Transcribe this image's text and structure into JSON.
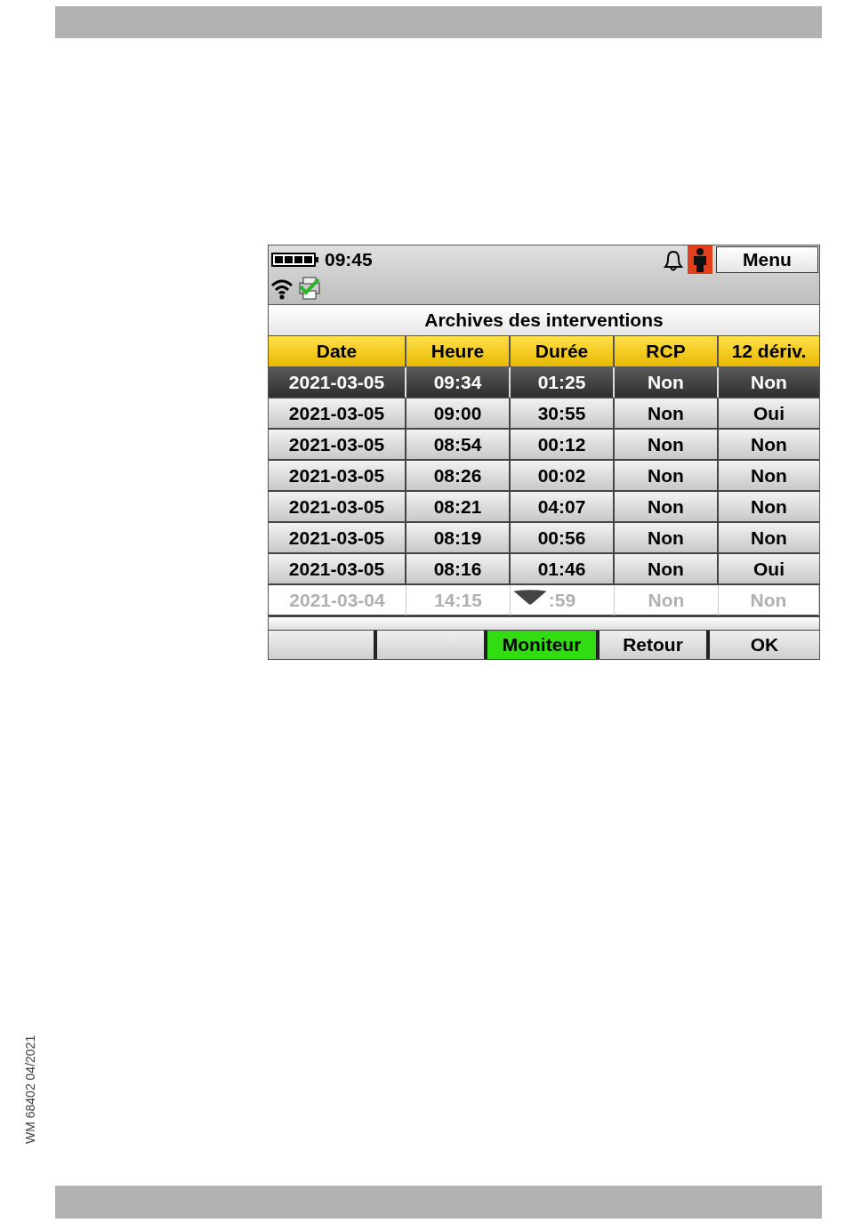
{
  "document_code": "WM 68402 04/2021",
  "device_screen": {
    "status_bar": {
      "time": "09:45",
      "menu_button": "Menu"
    },
    "title": "Archives des interventions",
    "table": {
      "columns": [
        "Date",
        "Heure",
        "Durée",
        "RCP",
        "12 dériv."
      ],
      "rows": [
        {
          "cells": [
            "2021-03-05",
            "09:34",
            "01:25",
            "Non",
            "Non"
          ],
          "selected": true,
          "faded": false
        },
        {
          "cells": [
            "2021-03-05",
            "09:00",
            "30:55",
            "Non",
            "Oui"
          ],
          "selected": false,
          "faded": false
        },
        {
          "cells": [
            "2021-03-05",
            "08:54",
            "00:12",
            "Non",
            "Non"
          ],
          "selected": false,
          "faded": false
        },
        {
          "cells": [
            "2021-03-05",
            "08:26",
            "00:02",
            "Non",
            "Non"
          ],
          "selected": false,
          "faded": false
        },
        {
          "cells": [
            "2021-03-05",
            "08:21",
            "04:07",
            "Non",
            "Non"
          ],
          "selected": false,
          "faded": false
        },
        {
          "cells": [
            "2021-03-05",
            "08:19",
            "00:56",
            "Non",
            "Non"
          ],
          "selected": false,
          "faded": false
        },
        {
          "cells": [
            "2021-03-05",
            "08:16",
            "01:46",
            "Non",
            "Oui"
          ],
          "selected": false,
          "faded": false
        },
        {
          "cells": [
            "2021-03-04",
            "14:15",
            ":59",
            "Non",
            "Non"
          ],
          "selected": false,
          "faded": true
        }
      ]
    },
    "softkeys": [
      {
        "highlighted": false
      },
      {
        "highlighted": false
      },
      {
        "label": "Moniteur",
        "highlighted": true
      },
      {
        "label": "Retour",
        "highlighted": false
      },
      {
        "label": "OK",
        "highlighted": false
      }
    ]
  }
}
